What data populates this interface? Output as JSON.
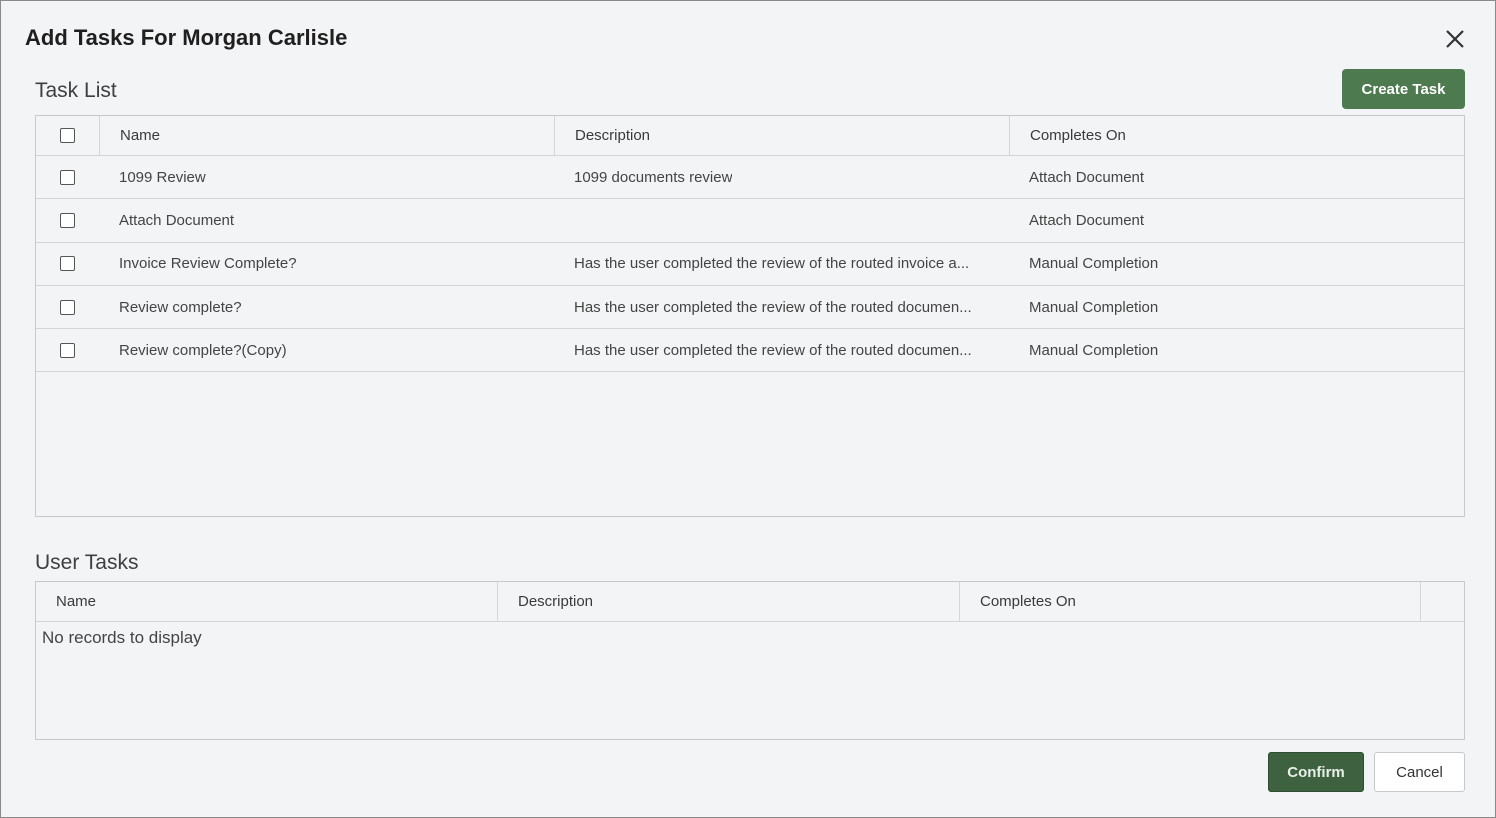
{
  "dialog": {
    "title": "Add Tasks For Morgan Carlisle",
    "close_icon": "close-icon"
  },
  "task_list": {
    "title": "Task List",
    "create_button": "Create Task",
    "columns": [
      "Name",
      "Description",
      "Completes On"
    ],
    "rows": [
      {
        "name": "1099 Review",
        "description": "1099 documents review",
        "completes_on": "Attach Document"
      },
      {
        "name": "Attach Document",
        "description": "",
        "completes_on": "Attach Document"
      },
      {
        "name": "Invoice Review Complete?",
        "description": "Has the user completed the review of the routed invoice a...",
        "completes_on": "Manual Completion"
      },
      {
        "name": "Review complete?",
        "description": "Has the user completed the review of the routed documen...",
        "completes_on": "Manual Completion"
      },
      {
        "name": "Review complete?(Copy)",
        "description": "Has the user completed the review of the routed documen...",
        "completes_on": "Manual Completion"
      }
    ]
  },
  "user_tasks": {
    "title": "User Tasks",
    "columns": [
      "Name",
      "Description",
      "Completes On"
    ],
    "empty_message": "No records to display"
  },
  "footer": {
    "confirm_label": "Confirm",
    "cancel_label": "Cancel"
  },
  "colors": {
    "create_button": "#4d7a4f",
    "confirm_button": "#3e6240",
    "background": "#f3f4f6"
  }
}
